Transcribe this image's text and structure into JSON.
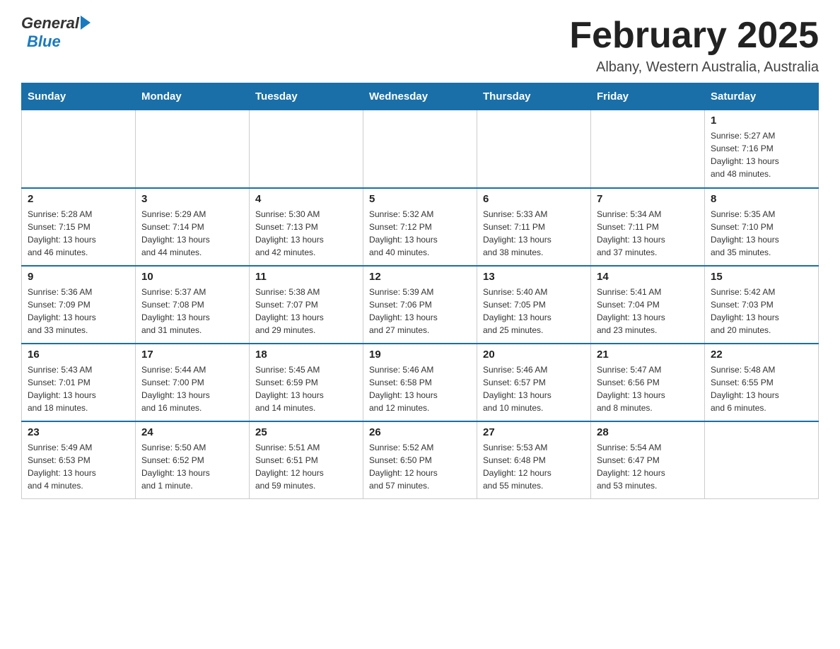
{
  "header": {
    "title": "February 2025",
    "location": "Albany, Western Australia, Australia",
    "logo_general": "General",
    "logo_blue": "Blue"
  },
  "weekdays": [
    "Sunday",
    "Monday",
    "Tuesday",
    "Wednesday",
    "Thursday",
    "Friday",
    "Saturday"
  ],
  "weeks": [
    [
      {
        "day": "",
        "info": ""
      },
      {
        "day": "",
        "info": ""
      },
      {
        "day": "",
        "info": ""
      },
      {
        "day": "",
        "info": ""
      },
      {
        "day": "",
        "info": ""
      },
      {
        "day": "",
        "info": ""
      },
      {
        "day": "1",
        "info": "Sunrise: 5:27 AM\nSunset: 7:16 PM\nDaylight: 13 hours\nand 48 minutes."
      }
    ],
    [
      {
        "day": "2",
        "info": "Sunrise: 5:28 AM\nSunset: 7:15 PM\nDaylight: 13 hours\nand 46 minutes."
      },
      {
        "day": "3",
        "info": "Sunrise: 5:29 AM\nSunset: 7:14 PM\nDaylight: 13 hours\nand 44 minutes."
      },
      {
        "day": "4",
        "info": "Sunrise: 5:30 AM\nSunset: 7:13 PM\nDaylight: 13 hours\nand 42 minutes."
      },
      {
        "day": "5",
        "info": "Sunrise: 5:32 AM\nSunset: 7:12 PM\nDaylight: 13 hours\nand 40 minutes."
      },
      {
        "day": "6",
        "info": "Sunrise: 5:33 AM\nSunset: 7:11 PM\nDaylight: 13 hours\nand 38 minutes."
      },
      {
        "day": "7",
        "info": "Sunrise: 5:34 AM\nSunset: 7:11 PM\nDaylight: 13 hours\nand 37 minutes."
      },
      {
        "day": "8",
        "info": "Sunrise: 5:35 AM\nSunset: 7:10 PM\nDaylight: 13 hours\nand 35 minutes."
      }
    ],
    [
      {
        "day": "9",
        "info": "Sunrise: 5:36 AM\nSunset: 7:09 PM\nDaylight: 13 hours\nand 33 minutes."
      },
      {
        "day": "10",
        "info": "Sunrise: 5:37 AM\nSunset: 7:08 PM\nDaylight: 13 hours\nand 31 minutes."
      },
      {
        "day": "11",
        "info": "Sunrise: 5:38 AM\nSunset: 7:07 PM\nDaylight: 13 hours\nand 29 minutes."
      },
      {
        "day": "12",
        "info": "Sunrise: 5:39 AM\nSunset: 7:06 PM\nDaylight: 13 hours\nand 27 minutes."
      },
      {
        "day": "13",
        "info": "Sunrise: 5:40 AM\nSunset: 7:05 PM\nDaylight: 13 hours\nand 25 minutes."
      },
      {
        "day": "14",
        "info": "Sunrise: 5:41 AM\nSunset: 7:04 PM\nDaylight: 13 hours\nand 23 minutes."
      },
      {
        "day": "15",
        "info": "Sunrise: 5:42 AM\nSunset: 7:03 PM\nDaylight: 13 hours\nand 20 minutes."
      }
    ],
    [
      {
        "day": "16",
        "info": "Sunrise: 5:43 AM\nSunset: 7:01 PM\nDaylight: 13 hours\nand 18 minutes."
      },
      {
        "day": "17",
        "info": "Sunrise: 5:44 AM\nSunset: 7:00 PM\nDaylight: 13 hours\nand 16 minutes."
      },
      {
        "day": "18",
        "info": "Sunrise: 5:45 AM\nSunset: 6:59 PM\nDaylight: 13 hours\nand 14 minutes."
      },
      {
        "day": "19",
        "info": "Sunrise: 5:46 AM\nSunset: 6:58 PM\nDaylight: 13 hours\nand 12 minutes."
      },
      {
        "day": "20",
        "info": "Sunrise: 5:46 AM\nSunset: 6:57 PM\nDaylight: 13 hours\nand 10 minutes."
      },
      {
        "day": "21",
        "info": "Sunrise: 5:47 AM\nSunset: 6:56 PM\nDaylight: 13 hours\nand 8 minutes."
      },
      {
        "day": "22",
        "info": "Sunrise: 5:48 AM\nSunset: 6:55 PM\nDaylight: 13 hours\nand 6 minutes."
      }
    ],
    [
      {
        "day": "23",
        "info": "Sunrise: 5:49 AM\nSunset: 6:53 PM\nDaylight: 13 hours\nand 4 minutes."
      },
      {
        "day": "24",
        "info": "Sunrise: 5:50 AM\nSunset: 6:52 PM\nDaylight: 13 hours\nand 1 minute."
      },
      {
        "day": "25",
        "info": "Sunrise: 5:51 AM\nSunset: 6:51 PM\nDaylight: 12 hours\nand 59 minutes."
      },
      {
        "day": "26",
        "info": "Sunrise: 5:52 AM\nSunset: 6:50 PM\nDaylight: 12 hours\nand 57 minutes."
      },
      {
        "day": "27",
        "info": "Sunrise: 5:53 AM\nSunset: 6:48 PM\nDaylight: 12 hours\nand 55 minutes."
      },
      {
        "day": "28",
        "info": "Sunrise: 5:54 AM\nSunset: 6:47 PM\nDaylight: 12 hours\nand 53 minutes."
      },
      {
        "day": "",
        "info": ""
      }
    ]
  ]
}
